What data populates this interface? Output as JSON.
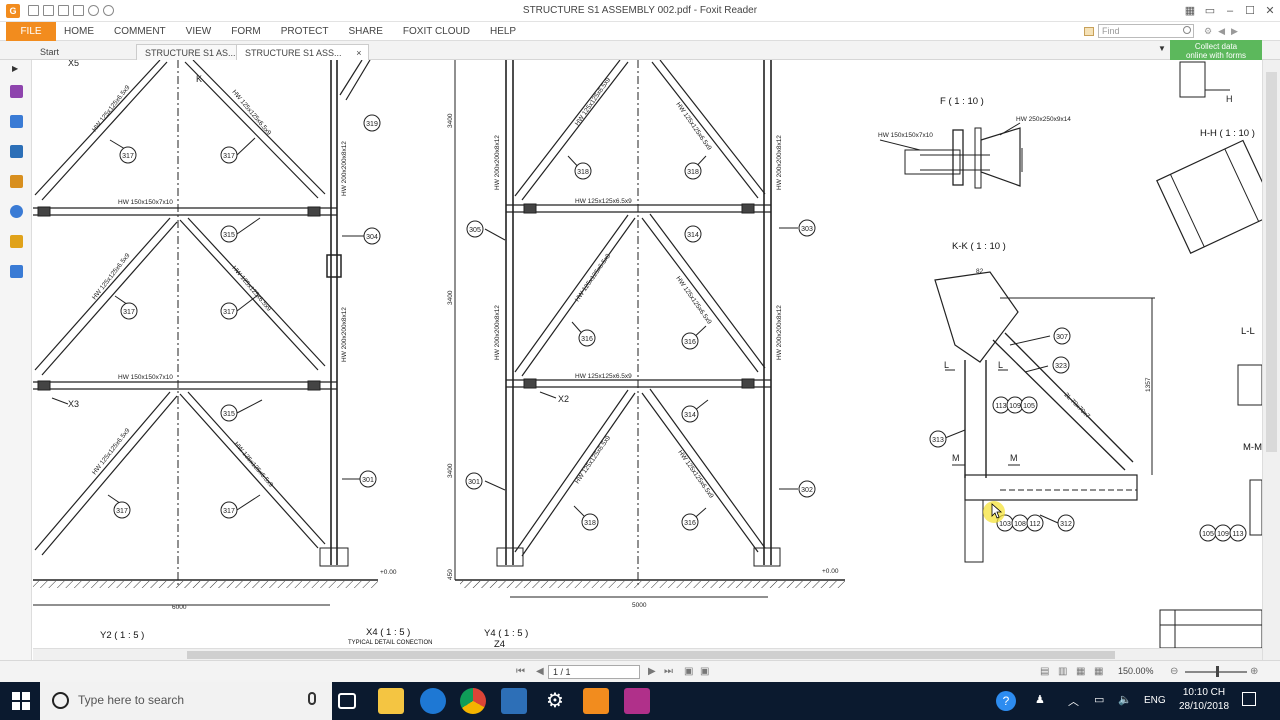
{
  "window": {
    "title": "STRUCTURE S1 ASSEMBLY 002.pdf - Foxit Reader"
  },
  "ribbon": {
    "file": "FILE",
    "menus": [
      "HOME",
      "COMMENT",
      "VIEW",
      "FORM",
      "PROTECT",
      "SHARE",
      "FOXIT CLOUD",
      "HELP"
    ],
    "find_placeholder": "Find"
  },
  "tabs": [
    "Start",
    "STRUCTURE S1 AS...",
    "STRUCTURE S1 ASS..."
  ],
  "collect_banner": {
    "line1": "Collect data",
    "line2": "online with forms"
  },
  "drawing": {
    "view_titles": [
      "Y2 ( 1 : 5 )",
      "X4 ( 1 : 5 )",
      "Y4 ( 1 : 5 )",
      "F ( 1 : 10 )",
      "K-K ( 1 : 10 )",
      "H-H ( 1 : 10 )",
      "L-L",
      "M-M"
    ],
    "view_subtitle": "TYPICAL DETAIL CONECTION",
    "z_label": "Z4",
    "section_labels": [
      "X5",
      "X3",
      "X2",
      "K",
      "H",
      "L",
      "L",
      "M",
      "M"
    ],
    "member_labels": [
      "HW 125x125x6.5x9",
      "HW 150x150x7x10",
      "HW 200x200x8x12",
      "HW 250x250x9x14",
      "2L 70x70x7"
    ],
    "callouts": [
      "317",
      "315",
      "319",
      "304",
      "301",
      "305",
      "318",
      "316",
      "314",
      "303",
      "302",
      "307",
      "323",
      "313",
      "312",
      "113",
      "109",
      "105",
      "103",
      "108",
      "112"
    ],
    "dimensions": [
      "6000",
      "5000",
      "3400",
      "+0.00",
      "450",
      "1357",
      "82"
    ]
  },
  "status": {
    "page": "1 / 1",
    "zoom": "150.00%"
  },
  "taskbar": {
    "search_placeholder": "Type here to search",
    "lang": "ENG",
    "time": "10:10 CH",
    "date": "28/10/2018"
  }
}
